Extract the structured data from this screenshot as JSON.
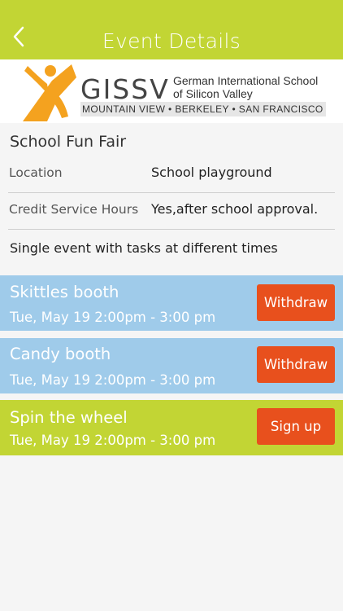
{
  "header": {
    "title": "Event Details",
    "back_icon": "chevron-left-icon",
    "bg_color": "#c2d534"
  },
  "banner": {
    "logo_text": "GISSV",
    "school_name_line1": "German International School",
    "school_name_line2": "of Silicon Valley",
    "campuses": "MOUNTAIN VIEW  •  BERKELEY  •  SAN FRANCISCO"
  },
  "event": {
    "title": "School Fun Fair",
    "details": [
      {
        "label": "Location",
        "value": "School playground"
      },
      {
        "label": "Credit Service Hours",
        "value": "Yes,after school approval."
      }
    ],
    "description": "Single event with tasks at different times"
  },
  "tasks": [
    {
      "name": "Skittles booth",
      "time": "Tue, May 19  2:00pm - 3:00 pm",
      "action": "Withdraw",
      "status": "signed-up",
      "color": "#9fcbea"
    },
    {
      "name": "Candy booth",
      "time": "Tue, May 19  2:00pm - 3:00 pm",
      "action": "Withdraw",
      "status": "signed-up",
      "color": "#9fcbea"
    },
    {
      "name": "Spin the wheel",
      "time": "Tue, May 19  2:00pm - 3:00 pm",
      "action": "Sign up",
      "status": "available",
      "color": "#c2d534"
    }
  ],
  "colors": {
    "accent_green": "#c2d534",
    "signed_blue": "#9fcbea",
    "action_orange": "#e8501d"
  }
}
